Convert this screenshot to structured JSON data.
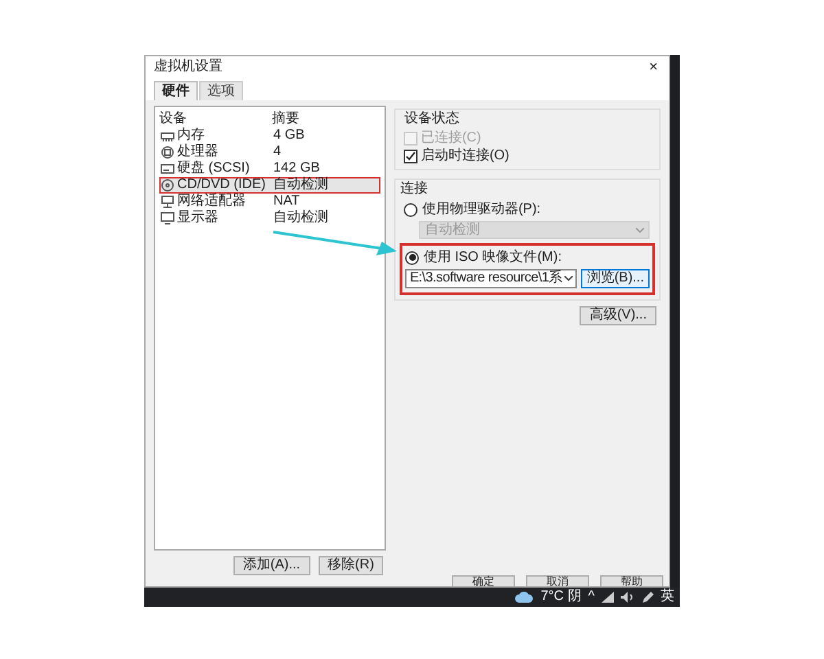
{
  "window": {
    "title": "虚拟机设置",
    "close": "×"
  },
  "tabs": [
    {
      "label": "硬件",
      "selected": true
    },
    {
      "label": "选项",
      "selected": false
    }
  ],
  "device_table": {
    "columns": [
      "设备",
      "摘要"
    ],
    "rows": [
      {
        "kind": "memory",
        "device": "内存",
        "summary": "4 GB",
        "selected": false,
        "annotated": false
      },
      {
        "kind": "cpu",
        "device": "处理器",
        "summary": "4",
        "selected": false,
        "annotated": false
      },
      {
        "kind": "disk",
        "device": "硬盘 (SCSI)",
        "summary": "142 GB",
        "selected": false,
        "annotated": false
      },
      {
        "kind": "cdrom",
        "device": "CD/DVD (IDE)",
        "summary": "自动检测",
        "selected": true,
        "annotated": true
      },
      {
        "kind": "network",
        "device": "网络适配器",
        "summary": "NAT",
        "selected": false,
        "annotated": false
      },
      {
        "kind": "display",
        "device": "显示器",
        "summary": "自动检测",
        "selected": false,
        "annotated": false
      }
    ]
  },
  "list_buttons": [
    "添加(A)...",
    "移除(R)"
  ],
  "device_status": {
    "title": "设备状态",
    "options": [
      {
        "label": "已连接(C)",
        "checked": false,
        "disabled": true
      },
      {
        "label": "启动时连接(O)",
        "checked": true,
        "disabled": false
      }
    ]
  },
  "connection": {
    "title": "连接",
    "physical": {
      "label": "使用物理驱动器(P):",
      "selected": false,
      "value": "自动检测",
      "disabled": true
    },
    "iso": {
      "label": "使用 ISO 映像文件(M):",
      "selected": true,
      "value": "E:\\3.software resource\\1系",
      "browse": "浏览(B)...",
      "annotated": true
    },
    "advanced": "高级(V)..."
  },
  "dialog_buttons": [
    "确定",
    "取消",
    "帮助"
  ],
  "taskbar": {
    "weather": "7°C 阴",
    "chevron": "^",
    "ime": "英"
  }
}
